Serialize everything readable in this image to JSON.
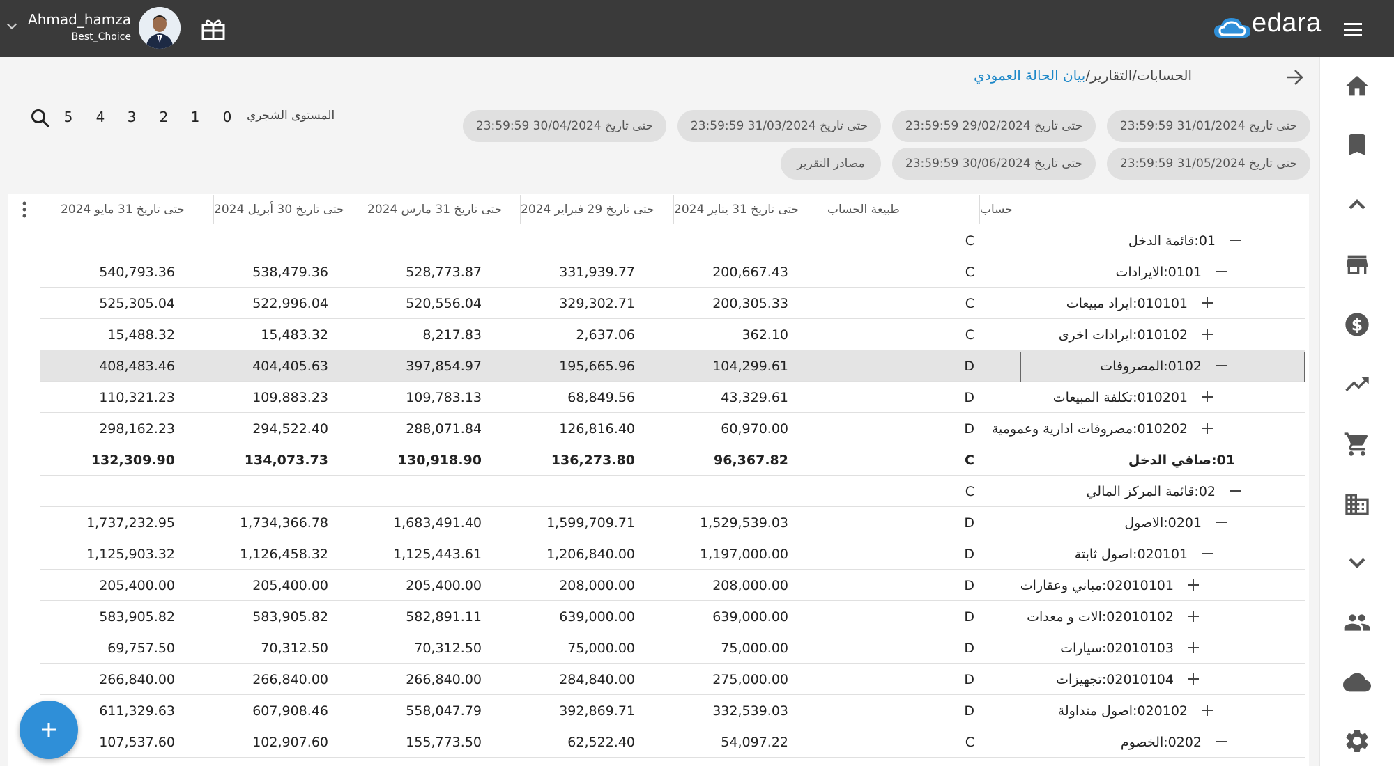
{
  "topbar": {
    "user_name": "Ahmad_hamza",
    "company": "Best_Choice",
    "logo_text": "edara",
    "brand_color": "#2f8fd8",
    "bar_color": "#3a3a3a"
  },
  "breadcrumb": {
    "accounts": "الحسابات",
    "reports": "/التقارير/",
    "current": "بيان الحالة العمودي"
  },
  "filters": {
    "periods": [
      "حتى تاريخ 31/01/2024 23:59:59",
      "حتى تاريخ 29/02/2024 23:59:59",
      "حتى تاريخ 31/03/2024 23:59:59",
      "حتى تاريخ 30/04/2024 23:59:59",
      "حتى تاريخ 31/05/2024 23:59:59",
      "حتى تاريخ 30/06/2024 23:59:59"
    ],
    "sources": "مصادر التقرير",
    "level_label": "المستوى الشجري",
    "levels": [
      "0",
      "1",
      "2",
      "3",
      "4",
      "5"
    ]
  },
  "table": {
    "headers": {
      "account": "حساب",
      "nature": "طبيعة الحساب",
      "jan": "حتى تاريخ 31 يناير 2024",
      "feb": "حتى تاريخ 29 فبراير 2024",
      "mar": "حتى تاريخ 31 مارس 2024",
      "apr": "حتى تاريخ 30 أبريل 2024",
      "may": "حتى تاريخ 31 مايو 2024"
    },
    "rows": [
      {
        "account": "01:قائمة الدخل",
        "nature": "C",
        "jan": "",
        "feb": "",
        "mar": "",
        "apr": "",
        "may": ""
      },
      {
        "account": "0101:الايرادات",
        "nature": "C",
        "jan": "200,667.43",
        "feb": "331,939.77",
        "mar": "528,773.87",
        "apr": "538,479.36",
        "may": "540,793.36"
      },
      {
        "account": "010101:ايراد مبيعات",
        "nature": "C",
        "jan": "200,305.33",
        "feb": "329,302.71",
        "mar": "520,556.04",
        "apr": "522,996.04",
        "may": "525,305.04"
      },
      {
        "account": "010102:ايرادات اخرى",
        "nature": "C",
        "jan": "362.10",
        "feb": "2,637.06",
        "mar": "8,217.83",
        "apr": "15,483.32",
        "may": "15,488.32"
      },
      {
        "account": "0102:المصروفات",
        "nature": "D",
        "jan": "104,299.61",
        "feb": "195,665.96",
        "mar": "397,854.97",
        "apr": "404,405.63",
        "may": "408,483.46"
      },
      {
        "account": "010201:تكلفة المبيعات",
        "nature": "D",
        "jan": "43,329.61",
        "feb": "68,849.56",
        "mar": "109,783.13",
        "apr": "109,883.23",
        "may": "110,321.23"
      },
      {
        "account": "010202:مصروفات ادارية وعمومية",
        "nature": "D",
        "jan": "60,970.00",
        "feb": "126,816.40",
        "mar": "288,071.84",
        "apr": "294,522.40",
        "may": "298,162.23"
      },
      {
        "account": "01:صافي الدخل",
        "nature": "C",
        "jan": "96,367.82",
        "feb": "136,273.80",
        "mar": "130,918.90",
        "apr": "134,073.73",
        "may": "132,309.90"
      },
      {
        "account": "02:قائمة المركز المالي",
        "nature": "C",
        "jan": "",
        "feb": "",
        "mar": "",
        "apr": "",
        "may": ""
      },
      {
        "account": "0201:الاصول",
        "nature": "D",
        "jan": "1,529,539.03",
        "feb": "1,599,709.71",
        "mar": "1,683,491.40",
        "apr": "1,734,366.78",
        "may": "1,737,232.95"
      },
      {
        "account": "020101:اصول ثابتة",
        "nature": "D",
        "jan": "1,197,000.00",
        "feb": "1,206,840.00",
        "mar": "1,125,443.61",
        "apr": "1,126,458.32",
        "may": "1,125,903.32"
      },
      {
        "account": "02010101:مباني وعقارات",
        "nature": "D",
        "jan": "208,000.00",
        "feb": "208,000.00",
        "mar": "205,400.00",
        "apr": "205,400.00",
        "may": "205,400.00"
      },
      {
        "account": "02010102:الات و معدات",
        "nature": "D",
        "jan": "639,000.00",
        "feb": "639,000.00",
        "mar": "582,891.11",
        "apr": "583,905.82",
        "may": "583,905.82"
      },
      {
        "account": "02010103:سيارات",
        "nature": "D",
        "jan": "75,000.00",
        "feb": "75,000.00",
        "mar": "70,312.50",
        "apr": "70,312.50",
        "may": "69,757.50"
      },
      {
        "account": "02010104:تجهيزات",
        "nature": "D",
        "jan": "275,000.00",
        "feb": "284,840.00",
        "mar": "266,840.00",
        "apr": "266,840.00",
        "may": "266,840.00"
      },
      {
        "account": "020102:اصول متداولة",
        "nature": "D",
        "jan": "332,539.03",
        "feb": "392,869.71",
        "mar": "558,047.79",
        "apr": "607,908.46",
        "may": "611,329.63"
      },
      {
        "account": "0202:الخصوم",
        "nature": "C",
        "jan": "54,097.22",
        "feb": "62,522.40",
        "mar": "155,773.50",
        "apr": "102,907.60",
        "may": "107,537.60"
      }
    ]
  },
  "icons": {
    "sidebar": [
      "home-icon",
      "bookmark-icon",
      "chevron-up-icon",
      "store-icon",
      "dollar-icon",
      "trending-up-icon",
      "cart-icon",
      "building-icon",
      "chevron-down-icon",
      "people-icon",
      "cloud-icon",
      "gear-icon"
    ]
  }
}
